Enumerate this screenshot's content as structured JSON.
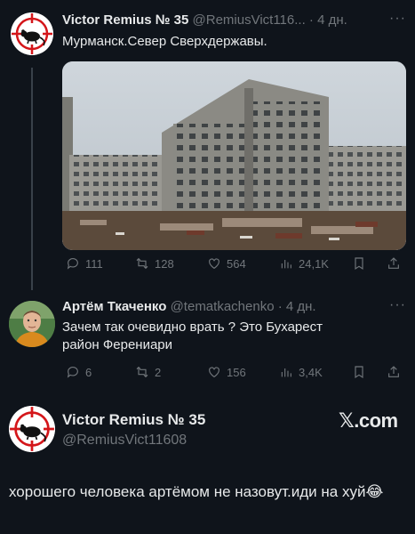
{
  "tweet1": {
    "name": "Victor Remius № 35",
    "handle": "@RemiusVict116...",
    "separator": "·",
    "time": "4 дн.",
    "more": "···",
    "text": "Мурманск.Север Сверхдержавы.",
    "replies": "111",
    "retweets": "128",
    "likes": "564",
    "views": "24,1K"
  },
  "tweet2": {
    "name": "Артём Ткаченко",
    "handle": "@tematkachenko",
    "separator": "·",
    "time": "4 дн.",
    "more": "···",
    "text_line1": "Зачем так очевидно врать ? Это Бухарест",
    "text_line2": "район Ферениари",
    "replies": "6",
    "retweets": "2",
    "likes": "156",
    "views": "3,4K"
  },
  "quote": {
    "name": "Victor Remius № 35",
    "handle": "@RemiusVict11608",
    "brand": "𝕏.com",
    "text": "хорошего человека артёмом не назовут.иди на хуй😂"
  },
  "icons": {
    "reply": "reply-icon",
    "retweet": "retweet-icon",
    "like": "heart-icon",
    "views": "views-icon",
    "bookmark": "bookmark-icon",
    "share": "share-icon"
  },
  "colors": {
    "background": "#0f141b",
    "text": "#e7e9ea",
    "muted": "#71767b",
    "avatar_red": "#d4161a"
  }
}
